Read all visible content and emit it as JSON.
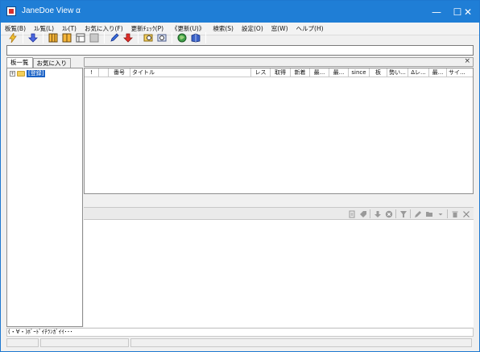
{
  "window": {
    "title": "JaneDoe View α",
    "controls": {
      "minimize": "—",
      "maximize": "☐",
      "close": "✕"
    }
  },
  "menu": [
    "板覧(B)",
    "ｽﾚ覧(L)",
    "ｽﾚ(T)",
    "お気に入り(F)",
    "更新ﾁｪｯｸ(P)",
    "《更新(U)》",
    "検索(S)",
    "設定(O)",
    "窓(W)",
    "ヘルプ(H)"
  ],
  "toolbar": {
    "icons": [
      "lightning-icon",
      "download-arrow-icon",
      "columns-icon",
      "split-view-icon",
      "single-pane-icon",
      "gray-pane-icon",
      "pencil-icon",
      "red-down-arrow-icon",
      "mail-search-icon",
      "mail-next-icon",
      "globe-icon",
      "book-icon"
    ]
  },
  "left_tabs": [
    "板一覧",
    "お気に入り"
  ],
  "tree": {
    "root_label": "[登録]",
    "expander": "+"
  },
  "thread_list": {
    "columns": [
      "!",
      "",
      "番号",
      "タイトル",
      "レス",
      "取得",
      "新着",
      "最...",
      "最...",
      "since",
      "板",
      "勢い...",
      "Δレ...",
      "最...",
      "サイ..."
    ]
  },
  "close_glyph": "×",
  "status_text": "(・∀・)ﾎﾞｰﾄﾞｲﾁﾗﾝｶﾞｲｲ･･･"
}
